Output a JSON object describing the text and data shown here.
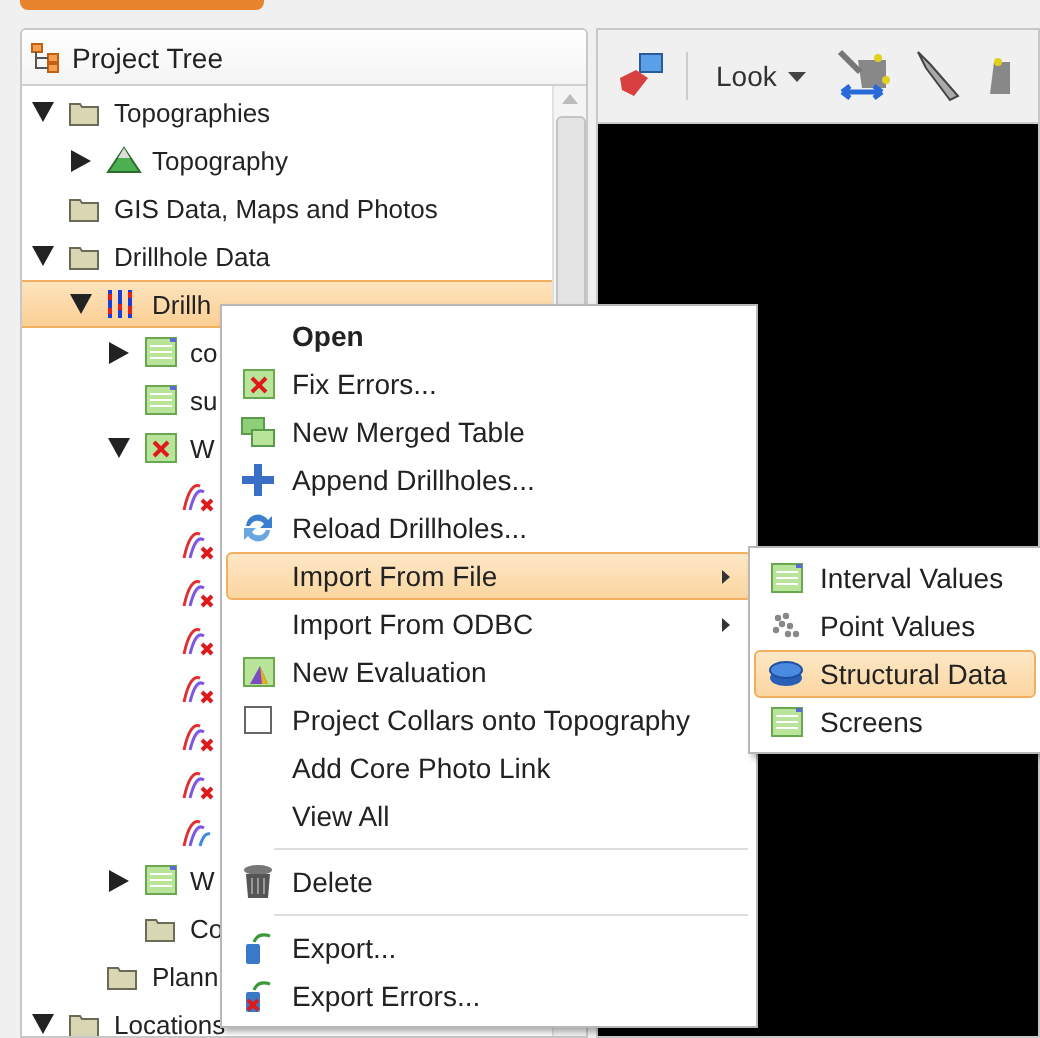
{
  "panel": {
    "title": "Project Tree"
  },
  "tree": [
    {
      "label": "Topographies",
      "kind": "folder",
      "expanded": true,
      "children": [
        {
          "label": "Topography",
          "kind": "terrain",
          "expanded": false
        }
      ]
    },
    {
      "label": "GIS Data, Maps and Photos",
      "kind": "folder"
    },
    {
      "label": "Drillhole Data",
      "kind": "folder",
      "expanded": true,
      "children": [
        {
          "label": "Drillh",
          "kind": "drillholes",
          "expanded": true,
          "selected": true,
          "children": [
            {
              "label": "co",
              "kind": "table",
              "expanded": false
            },
            {
              "label": "su",
              "kind": "table"
            },
            {
              "label": "W",
              "kind": "table-error",
              "expanded": true,
              "children": [
                {
                  "kind": "hole-error"
                },
                {
                  "kind": "hole-error"
                },
                {
                  "kind": "hole-error"
                },
                {
                  "kind": "hole-error"
                },
                {
                  "kind": "hole-error"
                },
                {
                  "kind": "hole-error"
                },
                {
                  "kind": "hole-error"
                },
                {
                  "kind": "hole"
                }
              ]
            },
            {
              "label": "W",
              "kind": "table",
              "expanded": false
            },
            {
              "label": "Co",
              "kind": "folder"
            }
          ]
        },
        {
          "label": "Plann",
          "kind": "folder"
        }
      ]
    },
    {
      "label": "Locations",
      "kind": "folder",
      "expanded": true
    }
  ],
  "toolbar": {
    "dropdown": "Look"
  },
  "context_menu": [
    {
      "kind": "item",
      "label": "Open",
      "bold": true
    },
    {
      "kind": "item",
      "label": "Fix Errors..."
    },
    {
      "kind": "item",
      "label": "New Merged Table"
    },
    {
      "kind": "item",
      "label": "Append Drillholes..."
    },
    {
      "kind": "item",
      "label": "Reload Drillholes..."
    },
    {
      "kind": "item",
      "label": "Import From File",
      "submenu": true,
      "selected": true
    },
    {
      "kind": "item",
      "label": "Import From ODBC",
      "submenu": true,
      "selected": false
    },
    {
      "kind": "item",
      "label": "New Evaluation"
    },
    {
      "kind": "checkbox",
      "label": "Project Collars onto Topography",
      "checked": false
    },
    {
      "kind": "item",
      "label": "Add Core Photo Link"
    },
    {
      "kind": "item",
      "label": "View All"
    },
    {
      "kind": "separator"
    },
    {
      "kind": "item",
      "label": "Delete"
    },
    {
      "kind": "separator"
    },
    {
      "kind": "item",
      "label": "Export..."
    },
    {
      "kind": "item",
      "label": "Export Errors..."
    }
  ],
  "submenu": [
    {
      "label": "Interval Values",
      "selected": false
    },
    {
      "label": "Point Values",
      "selected": false
    },
    {
      "label": "Structural Data",
      "selected": true
    },
    {
      "label": "Screens",
      "selected": false
    }
  ]
}
